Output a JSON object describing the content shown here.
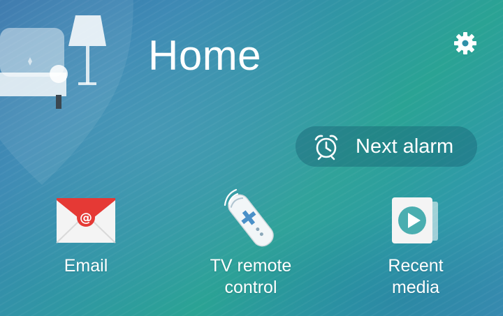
{
  "page": {
    "title": "Home"
  },
  "header": {
    "settings_icon": "gear-icon"
  },
  "next_alarm": {
    "label": "Next alarm",
    "icon": "alarm-clock-icon"
  },
  "apps": [
    {
      "label": "Email",
      "icon": "email-envelope-icon"
    },
    {
      "label_line1": "TV remote",
      "label_line2": "control",
      "icon": "tv-remote-icon"
    },
    {
      "label_line1": "Recent",
      "label_line2": "media",
      "icon": "play-media-icon"
    }
  ],
  "colors": {
    "accent_teal": "#2aa394",
    "email_red": "#e53935",
    "media_teal": "#4aaeb0",
    "remote_blue": "#4a90c8"
  }
}
